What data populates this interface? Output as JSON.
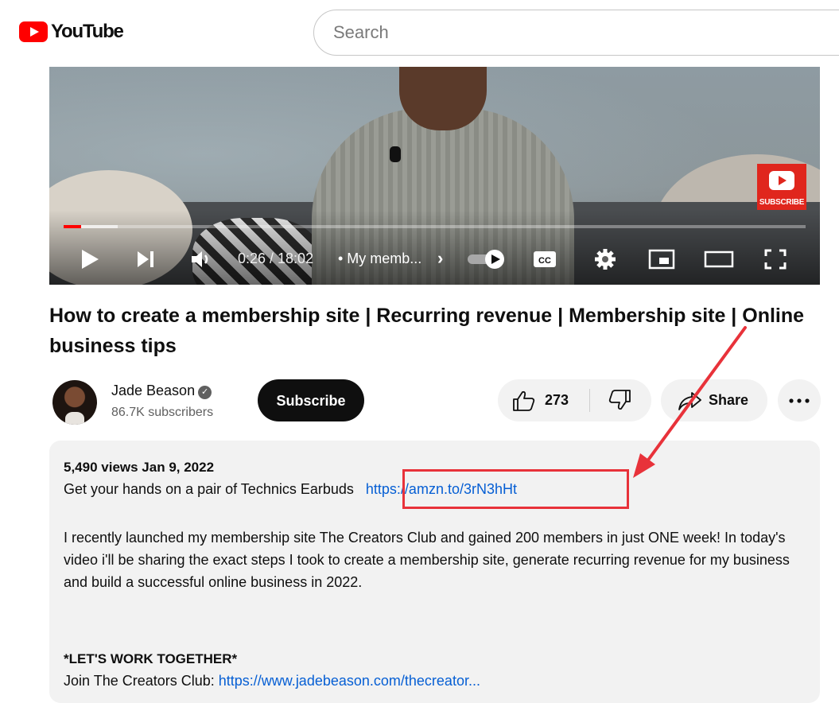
{
  "header": {
    "logo_text": "YouTube",
    "search_placeholder": "Search"
  },
  "player": {
    "subscribe_badge": "SUBSCRIBE",
    "time": "0:26 / 18:02",
    "chapter": "• My memb...",
    "progress_played_fraction": 0.024,
    "progress_buffered_fraction": 0.073
  },
  "video": {
    "title": "How to create a membership site | Recurring revenue | Membership site | Online business tips"
  },
  "channel": {
    "name": "Jade Beason",
    "subscribers": "86.7K subscribers",
    "subscribe_label": "Subscribe"
  },
  "actions": {
    "like_count": "273",
    "share_label": "Share"
  },
  "description": {
    "meta": "5,490 views  Jan 9, 2022",
    "line1_text": "Get your hands on a pair of Technics Earbuds",
    "line1_link": "https://amzn.to/3rN3hHt",
    "paragraph": "I recently launched my membership site The Creators Club and gained 200 members in just ONE week! In today's video i'll be sharing the exact steps I took to create a membership site, generate recurring revenue for my business and build a successful online business in 2022.",
    "section_heading": "*LET'S WORK TOGETHER*",
    "join_text": "Join The Creators Club:",
    "join_link": "https://www.jadebeason.com/thecreator..."
  },
  "colors": {
    "accent": "#ff0000",
    "link": "#065fd4",
    "annotation": "#e8323a"
  }
}
